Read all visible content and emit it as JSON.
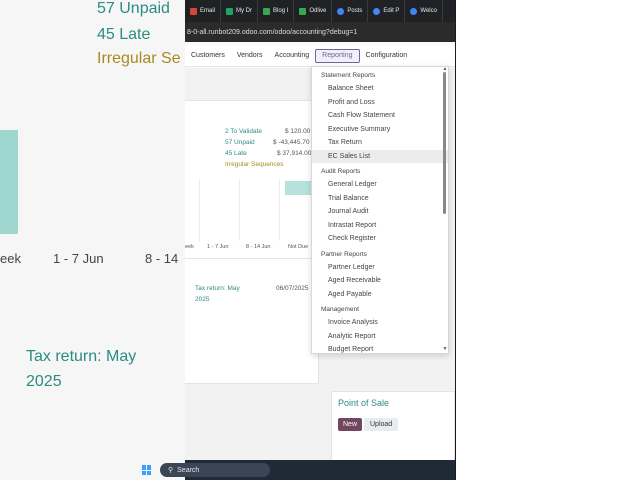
{
  "background": {
    "unpaid": "57 Unpaid",
    "late": "45 Late",
    "irregular": "Irregular Se",
    "labels": [
      "eek",
      "1 - 7 Jun",
      "8 - 14"
    ],
    "tax_return_line1": "Tax return: May",
    "tax_return_line2": "2025"
  },
  "browser_tabs": [
    {
      "label": "Email",
      "icon": "email-icon",
      "color": "#d44638"
    },
    {
      "label": "My Dr",
      "icon": "drive-icon",
      "color": "#1fa463"
    },
    {
      "label": "Blog I",
      "icon": "plus-icon",
      "color": "#34a853"
    },
    {
      "label": "Odlive",
      "icon": "plus-icon",
      "color": "#34a853"
    },
    {
      "label": "Posts",
      "icon": "globe-icon",
      "color": "#4285f4"
    },
    {
      "label": "Edit P",
      "icon": "globe-icon",
      "color": "#4285f4"
    },
    {
      "label": "Welco",
      "icon": "globe-icon",
      "color": "#4285f4"
    }
  ],
  "url": "8-0-all.runbot209.odoo.com/odoo/accounting?debug=1",
  "nav": {
    "items": [
      "Customers",
      "Vendors",
      "Accounting",
      "Reporting",
      "Configuration"
    ],
    "active": "Reporting"
  },
  "dashboard": {
    "to_validate": "2 To Validate",
    "to_validate_amt": "$ 120.00",
    "unpaid": "57 Unpaid",
    "unpaid_amt": "$ -43,445.70",
    "late": "45 Late",
    "late_amt": "$ 37,914.00",
    "irregular": "Irregular Sequences",
    "chart_labels": [
      "eek",
      "1 - 7 Jun",
      "8 - 14 Jun",
      "Not Due"
    ],
    "tax_line1": "Tax return: May",
    "tax_line2": "2025",
    "tax_date": "06/07/2025",
    "pos_title": "Point of Sale",
    "new_label": "New",
    "upload_label": "Upload"
  },
  "dropdown": {
    "sections": [
      {
        "title": "Statement Reports",
        "items": [
          "Balance Sheet",
          "Profit and Loss",
          "Cash Flow Statement",
          "Executive Summary",
          "Tax Return",
          "EC Sales List"
        ]
      },
      {
        "title": "Audit Reports",
        "items": [
          "General Ledger",
          "Trial Balance",
          "Journal Audit",
          "Intrastat Report",
          "Check Register"
        ]
      },
      {
        "title": "Partner Reports",
        "items": [
          "Partner Ledger",
          "Aged Receivable",
          "Aged Payable"
        ]
      },
      {
        "title": "Management",
        "items": [
          "Invoice Analysis",
          "Analytic Report",
          "Budget Report"
        ]
      }
    ],
    "hovered": "EC Sales List"
  },
  "taskbar": {
    "search_label": "Search"
  }
}
